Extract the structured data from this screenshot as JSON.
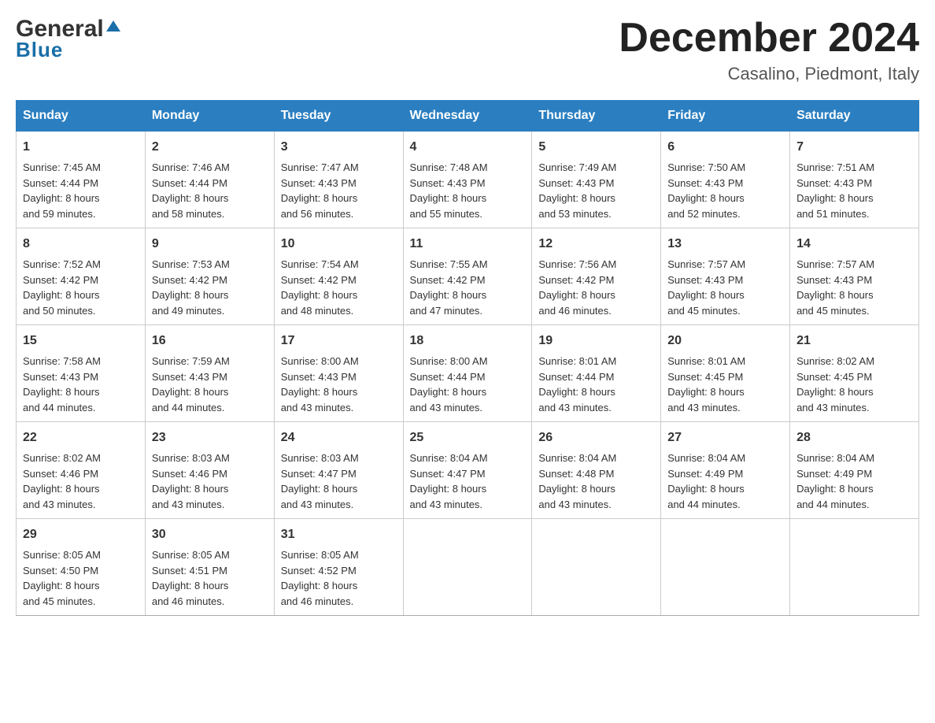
{
  "logo": {
    "general": "General",
    "blue": "Blue",
    "triangle_symbol": "▲"
  },
  "header": {
    "month_year": "December 2024",
    "location": "Casalino, Piedmont, Italy"
  },
  "days_of_week": [
    "Sunday",
    "Monday",
    "Tuesday",
    "Wednesday",
    "Thursday",
    "Friday",
    "Saturday"
  ],
  "weeks": [
    [
      {
        "day": "1",
        "sunrise": "Sunrise: 7:45 AM",
        "sunset": "Sunset: 4:44 PM",
        "daylight": "Daylight: 8 hours",
        "daylight2": "and 59 minutes."
      },
      {
        "day": "2",
        "sunrise": "Sunrise: 7:46 AM",
        "sunset": "Sunset: 4:44 PM",
        "daylight": "Daylight: 8 hours",
        "daylight2": "and 58 minutes."
      },
      {
        "day": "3",
        "sunrise": "Sunrise: 7:47 AM",
        "sunset": "Sunset: 4:43 PM",
        "daylight": "Daylight: 8 hours",
        "daylight2": "and 56 minutes."
      },
      {
        "day": "4",
        "sunrise": "Sunrise: 7:48 AM",
        "sunset": "Sunset: 4:43 PM",
        "daylight": "Daylight: 8 hours",
        "daylight2": "and 55 minutes."
      },
      {
        "day": "5",
        "sunrise": "Sunrise: 7:49 AM",
        "sunset": "Sunset: 4:43 PM",
        "daylight": "Daylight: 8 hours",
        "daylight2": "and 53 minutes."
      },
      {
        "day": "6",
        "sunrise": "Sunrise: 7:50 AM",
        "sunset": "Sunset: 4:43 PM",
        "daylight": "Daylight: 8 hours",
        "daylight2": "and 52 minutes."
      },
      {
        "day": "7",
        "sunrise": "Sunrise: 7:51 AM",
        "sunset": "Sunset: 4:43 PM",
        "daylight": "Daylight: 8 hours",
        "daylight2": "and 51 minutes."
      }
    ],
    [
      {
        "day": "8",
        "sunrise": "Sunrise: 7:52 AM",
        "sunset": "Sunset: 4:42 PM",
        "daylight": "Daylight: 8 hours",
        "daylight2": "and 50 minutes."
      },
      {
        "day": "9",
        "sunrise": "Sunrise: 7:53 AM",
        "sunset": "Sunset: 4:42 PM",
        "daylight": "Daylight: 8 hours",
        "daylight2": "and 49 minutes."
      },
      {
        "day": "10",
        "sunrise": "Sunrise: 7:54 AM",
        "sunset": "Sunset: 4:42 PM",
        "daylight": "Daylight: 8 hours",
        "daylight2": "and 48 minutes."
      },
      {
        "day": "11",
        "sunrise": "Sunrise: 7:55 AM",
        "sunset": "Sunset: 4:42 PM",
        "daylight": "Daylight: 8 hours",
        "daylight2": "and 47 minutes."
      },
      {
        "day": "12",
        "sunrise": "Sunrise: 7:56 AM",
        "sunset": "Sunset: 4:42 PM",
        "daylight": "Daylight: 8 hours",
        "daylight2": "and 46 minutes."
      },
      {
        "day": "13",
        "sunrise": "Sunrise: 7:57 AM",
        "sunset": "Sunset: 4:43 PM",
        "daylight": "Daylight: 8 hours",
        "daylight2": "and 45 minutes."
      },
      {
        "day": "14",
        "sunrise": "Sunrise: 7:57 AM",
        "sunset": "Sunset: 4:43 PM",
        "daylight": "Daylight: 8 hours",
        "daylight2": "and 45 minutes."
      }
    ],
    [
      {
        "day": "15",
        "sunrise": "Sunrise: 7:58 AM",
        "sunset": "Sunset: 4:43 PM",
        "daylight": "Daylight: 8 hours",
        "daylight2": "and 44 minutes."
      },
      {
        "day": "16",
        "sunrise": "Sunrise: 7:59 AM",
        "sunset": "Sunset: 4:43 PM",
        "daylight": "Daylight: 8 hours",
        "daylight2": "and 44 minutes."
      },
      {
        "day": "17",
        "sunrise": "Sunrise: 8:00 AM",
        "sunset": "Sunset: 4:43 PM",
        "daylight": "Daylight: 8 hours",
        "daylight2": "and 43 minutes."
      },
      {
        "day": "18",
        "sunrise": "Sunrise: 8:00 AM",
        "sunset": "Sunset: 4:44 PM",
        "daylight": "Daylight: 8 hours",
        "daylight2": "and 43 minutes."
      },
      {
        "day": "19",
        "sunrise": "Sunrise: 8:01 AM",
        "sunset": "Sunset: 4:44 PM",
        "daylight": "Daylight: 8 hours",
        "daylight2": "and 43 minutes."
      },
      {
        "day": "20",
        "sunrise": "Sunrise: 8:01 AM",
        "sunset": "Sunset: 4:45 PM",
        "daylight": "Daylight: 8 hours",
        "daylight2": "and 43 minutes."
      },
      {
        "day": "21",
        "sunrise": "Sunrise: 8:02 AM",
        "sunset": "Sunset: 4:45 PM",
        "daylight": "Daylight: 8 hours",
        "daylight2": "and 43 minutes."
      }
    ],
    [
      {
        "day": "22",
        "sunrise": "Sunrise: 8:02 AM",
        "sunset": "Sunset: 4:46 PM",
        "daylight": "Daylight: 8 hours",
        "daylight2": "and 43 minutes."
      },
      {
        "day": "23",
        "sunrise": "Sunrise: 8:03 AM",
        "sunset": "Sunset: 4:46 PM",
        "daylight": "Daylight: 8 hours",
        "daylight2": "and 43 minutes."
      },
      {
        "day": "24",
        "sunrise": "Sunrise: 8:03 AM",
        "sunset": "Sunset: 4:47 PM",
        "daylight": "Daylight: 8 hours",
        "daylight2": "and 43 minutes."
      },
      {
        "day": "25",
        "sunrise": "Sunrise: 8:04 AM",
        "sunset": "Sunset: 4:47 PM",
        "daylight": "Daylight: 8 hours",
        "daylight2": "and 43 minutes."
      },
      {
        "day": "26",
        "sunrise": "Sunrise: 8:04 AM",
        "sunset": "Sunset: 4:48 PM",
        "daylight": "Daylight: 8 hours",
        "daylight2": "and 43 minutes."
      },
      {
        "day": "27",
        "sunrise": "Sunrise: 8:04 AM",
        "sunset": "Sunset: 4:49 PM",
        "daylight": "Daylight: 8 hours",
        "daylight2": "and 44 minutes."
      },
      {
        "day": "28",
        "sunrise": "Sunrise: 8:04 AM",
        "sunset": "Sunset: 4:49 PM",
        "daylight": "Daylight: 8 hours",
        "daylight2": "and 44 minutes."
      }
    ],
    [
      {
        "day": "29",
        "sunrise": "Sunrise: 8:05 AM",
        "sunset": "Sunset: 4:50 PM",
        "daylight": "Daylight: 8 hours",
        "daylight2": "and 45 minutes."
      },
      {
        "day": "30",
        "sunrise": "Sunrise: 8:05 AM",
        "sunset": "Sunset: 4:51 PM",
        "daylight": "Daylight: 8 hours",
        "daylight2": "and 46 minutes."
      },
      {
        "day": "31",
        "sunrise": "Sunrise: 8:05 AM",
        "sunset": "Sunset: 4:52 PM",
        "daylight": "Daylight: 8 hours",
        "daylight2": "and 46 minutes."
      },
      {
        "day": "",
        "sunrise": "",
        "sunset": "",
        "daylight": "",
        "daylight2": ""
      },
      {
        "day": "",
        "sunrise": "",
        "sunset": "",
        "daylight": "",
        "daylight2": ""
      },
      {
        "day": "",
        "sunrise": "",
        "sunset": "",
        "daylight": "",
        "daylight2": ""
      },
      {
        "day": "",
        "sunrise": "",
        "sunset": "",
        "daylight": "",
        "daylight2": ""
      }
    ]
  ]
}
